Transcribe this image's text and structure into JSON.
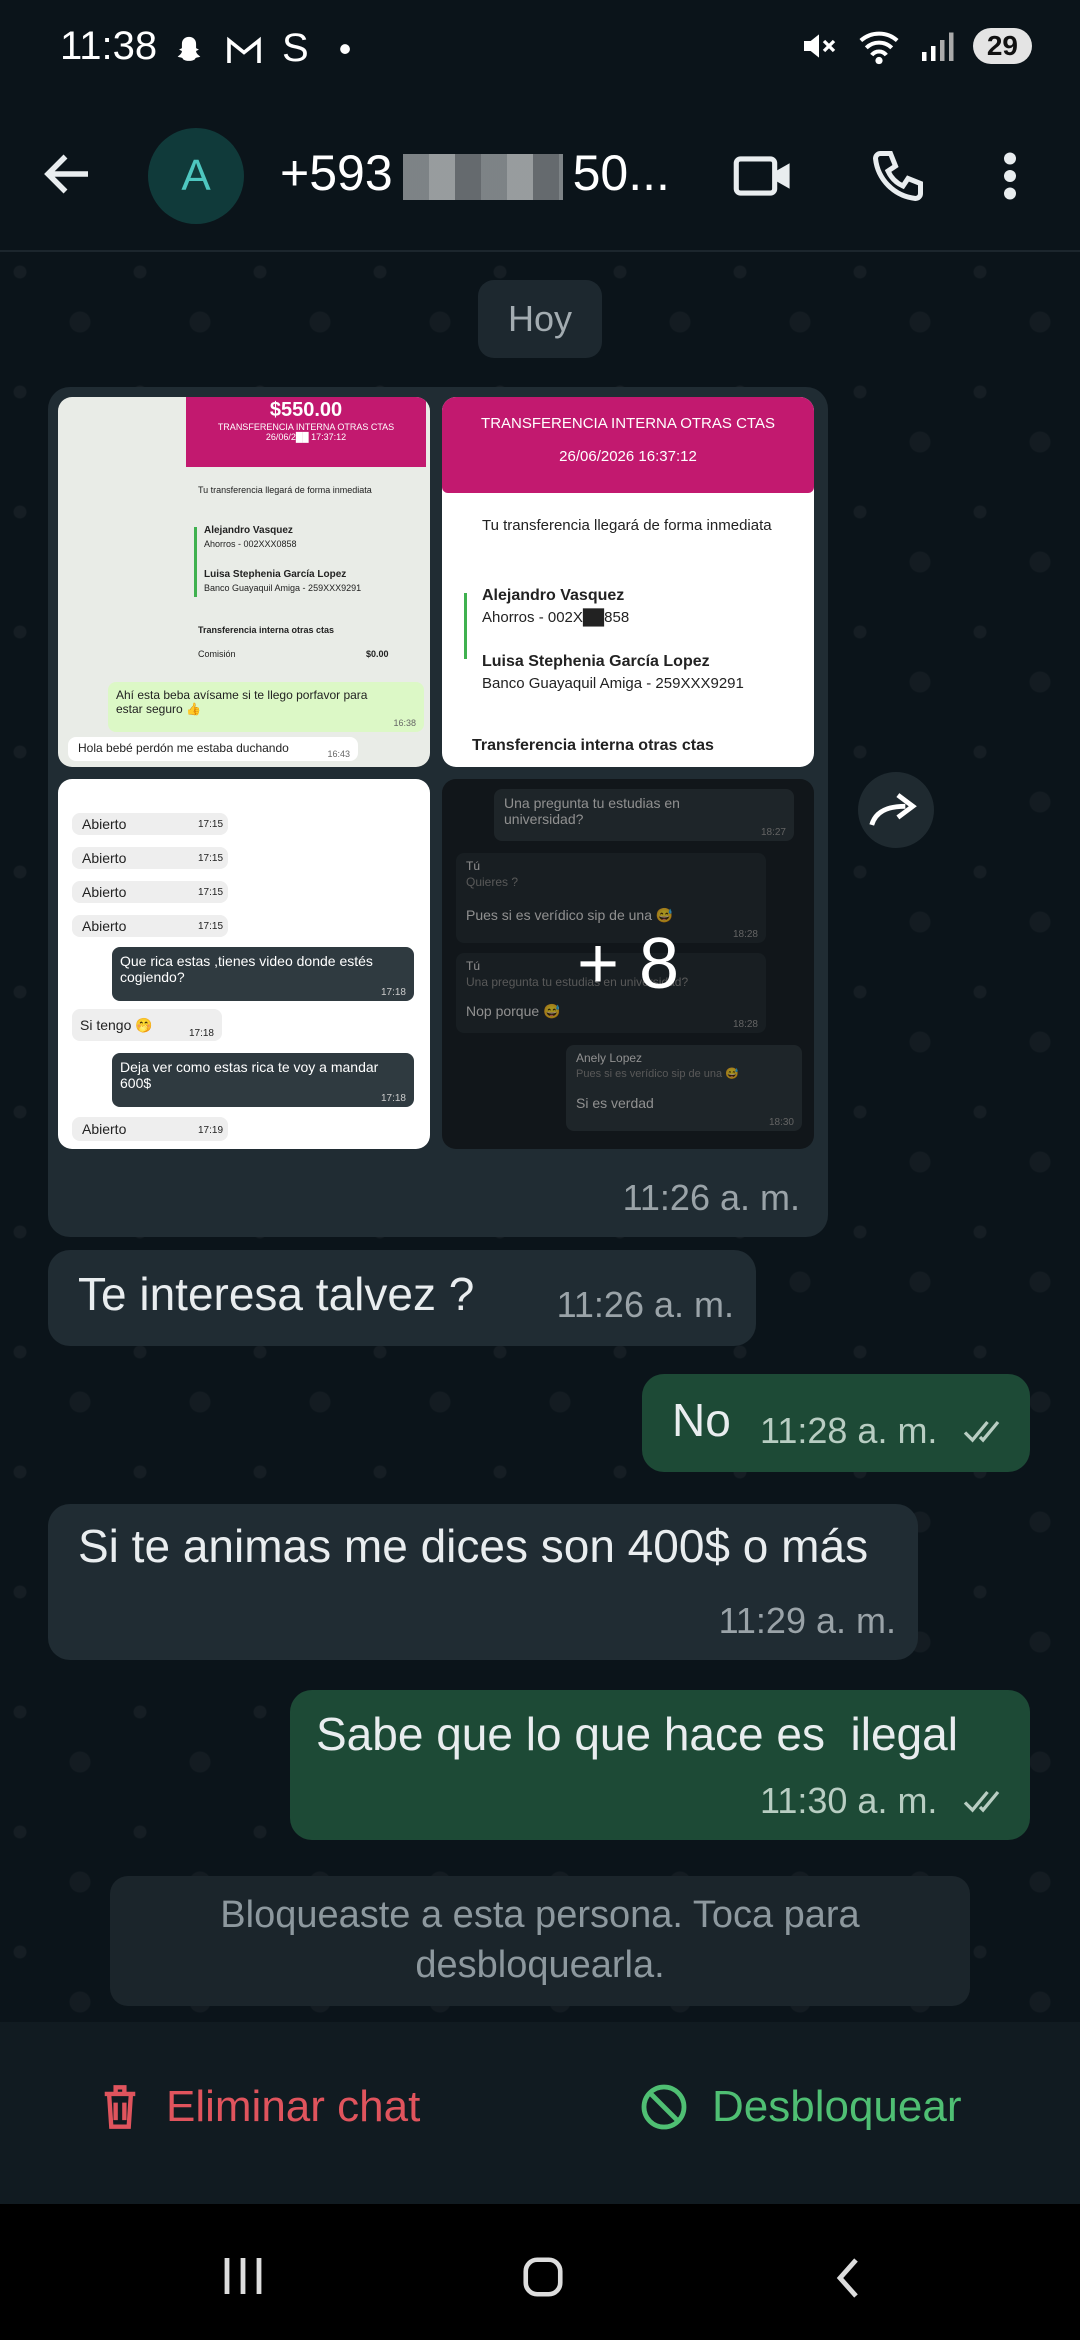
{
  "status_bar": {
    "time": "11:38",
    "left_icons": "•",
    "battery": "29"
  },
  "header": {
    "avatar_letter": "A",
    "phone_prefix": "+593",
    "phone_suffix": "50..."
  },
  "chat": {
    "date_label": "Hoy",
    "media": {
      "thumb1": {
        "amount": "$550.00",
        "title": "TRANSFERENCIA INTERNA OTRAS CTAS",
        "date": "26/06/2██ 17:37:12",
        "notice": "Tu transferencia llegará de forma inmediata",
        "from_name": "Alejandro Vasquez",
        "from_acct": "Ahorros - 002XXX0858",
        "to_name": "Luisa Stephenia García Lopez",
        "to_acct": "Banco Guayaquil Amiga - 259XXX9291",
        "type": "Transferencia interna otras ctas",
        "fee_label": "Comisión",
        "fee": "$0.00",
        "msg1": "Ahí esta beba avísame si te llego porfavor para estar seguro 👍",
        "msg1_time": "16:38",
        "msg2": "Hola bebé perdón me estaba duchando",
        "msg2_time": "16:43"
      },
      "thumb2": {
        "title": "TRANSFERENCIA INTERNA OTRAS CTAS",
        "date": "26/06/2026 16:37:12",
        "notice": "Tu transferencia llegará de forma inmediata",
        "from_name": "Alejandro Vasquez",
        "from_acct": "Ahorros - 002X██858",
        "to_name": "Luisa Stephenia García Lopez",
        "to_acct": "Banco Guayaquil Amiga - 259XXX9291",
        "type": "Transferencia interna otras ctas"
      },
      "thumb3": {
        "opened_label": "Abierto",
        "times": [
          "17:15",
          "17:15",
          "17:15",
          "17:15",
          "17:15"
        ],
        "msg1": "Que rica estas ,tienes video donde estés cogiendo?",
        "msg1_time": "17:18",
        "msg2": "Si tengo 🤭",
        "msg2_time": "17:18",
        "msg3": "Deja ver como estas rica te voy a mandar 600$",
        "msg3_time": "17:18",
        "last_time": "17:19"
      },
      "thumb4": {
        "q": "Una pregunta tu estudias en universidad?",
        "q_time": "18:27",
        "tu": "Tú",
        "quiere": "Quieres ?",
        "r1": "Pues si es verídico sip de una 😅",
        "r1_time": "18:28",
        "quote2": "Una pregunta tu estudias en universidad?",
        "r2": "Nop porque 😅",
        "r2_time": "18:28",
        "anely": "Anely Lopez",
        "quote3": "Pues si es verídico sip de una 😅",
        "r3": "Si es verdad",
        "r3_time": "18:30"
      },
      "more_count": "+ 8",
      "time": "11:26 a. m."
    },
    "messages": [
      {
        "dir": "in",
        "text": "Te interesa talvez ?",
        "time": "11:26 a. m."
      },
      {
        "dir": "out",
        "text": "No",
        "time": "11:28 a. m."
      },
      {
        "dir": "in",
        "text": "Si te animas me dices son 400$ o más",
        "time": "11:29 a. m."
      },
      {
        "dir": "out",
        "text": "Sabe que lo que hace es  ilegal",
        "time": "11:30 a. m."
      }
    ],
    "blocked_notice": "Bloqueaste a esta persona. Toca para desbloquearla."
  },
  "actions": {
    "delete": "Eliminar chat",
    "unblock": "Desbloquear"
  },
  "colors": {
    "incoming": "#202c33",
    "outgoing": "#1d4a36",
    "delete": "#e0545d",
    "unblock": "#4fbf73"
  },
  "icons": [
    "back-arrow-icon",
    "video-call-icon",
    "phone-icon",
    "more-vert-icon",
    "forward-icon",
    "trash-icon",
    "block-icon",
    "double-check-icon"
  ]
}
